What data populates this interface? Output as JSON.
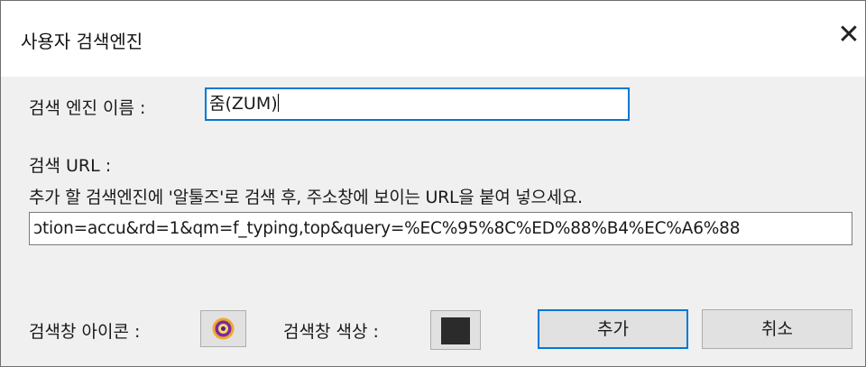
{
  "window": {
    "title": "사용자 검색엔진",
    "close_glyph": "✕"
  },
  "form": {
    "name_label": "검색 엔진 이름 :",
    "name_value": "줌(ZUM)",
    "url_label": "검색 URL :",
    "url_hint": "추가 할 검색엔진에 '알툴즈'로 검색 후, 주소창에 보이는 URL을 붙여 넣으세요.",
    "url_value": "ɔtion=accu&rd=1&qm=f_typing,top&query=%EC%95%8C%ED%88%B4%EC%A6%88"
  },
  "footer": {
    "icon_label": "검색창 아이콘 :",
    "icon_name": "zum-logo-icon",
    "color_label": "검색창 색상 :",
    "color_value": "#2b2b2b",
    "add_label": "추가",
    "cancel_label": "취소"
  }
}
